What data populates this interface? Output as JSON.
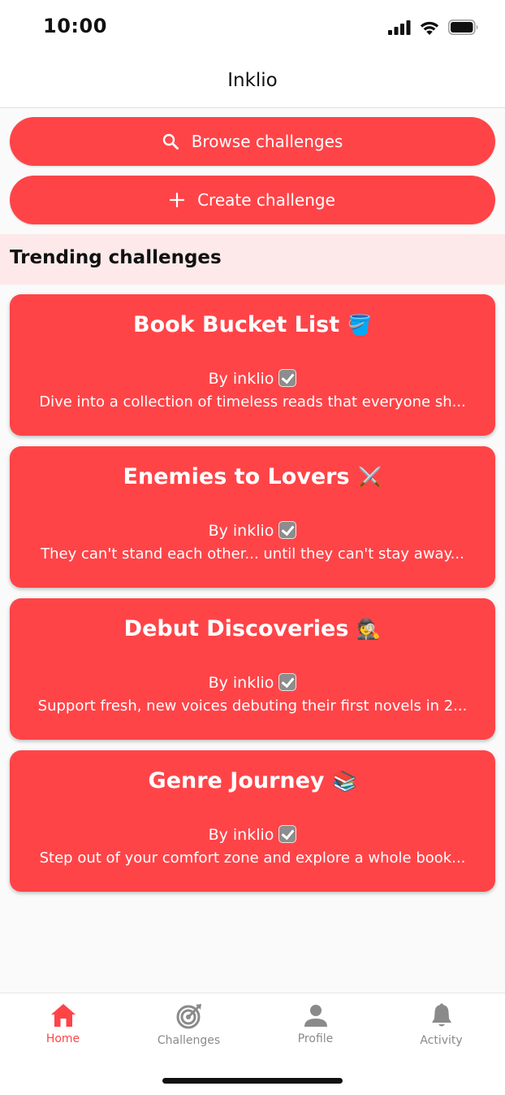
{
  "status_bar": {
    "time": "10:00"
  },
  "header": {
    "title": "Inklio"
  },
  "actions": {
    "browse_label": "Browse challenges",
    "create_label": "Create challenge"
  },
  "trending": {
    "title": "Trending challenges",
    "cards": [
      {
        "title": "Book Bucket List",
        "emoji": "🪣",
        "author": "By inklio",
        "description": "Dive into a collection of timeless reads that everyone sh..."
      },
      {
        "title": "Enemies to Lovers",
        "emoji": "⚔️",
        "author": "By inklio",
        "description": "They can't stand each other... until they can't stay away..."
      },
      {
        "title": "Debut Discoveries",
        "emoji": "🕵️",
        "author": "By inklio",
        "description": "Support fresh, new voices debuting their first novels in 2..."
      },
      {
        "title": "Genre Journey",
        "emoji": "📚",
        "author": "By inklio",
        "description": "Step out of your comfort zone and explore a whole book..."
      }
    ]
  },
  "bottom_nav": {
    "items": [
      {
        "label": "Home",
        "icon": "home-icon"
      },
      {
        "label": "Challenges",
        "icon": "target-icon"
      },
      {
        "label": "Profile",
        "icon": "person-icon"
      },
      {
        "label": "Activity",
        "icon": "bell-icon"
      }
    ],
    "active": "Home"
  },
  "colors": {
    "accent": "#ff4448",
    "section_bg": "#fde9e9",
    "nav_inactive": "#8a8a8a"
  }
}
